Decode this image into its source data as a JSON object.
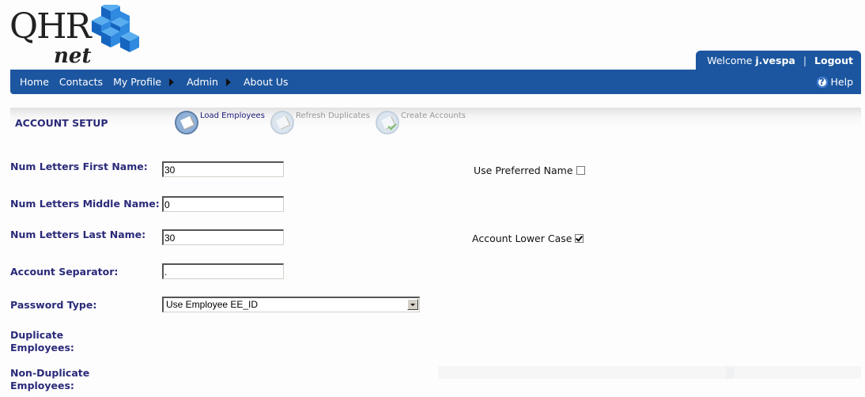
{
  "logo": {
    "brand": "QHR",
    "suffix": "net",
    "colors": {
      "cube_blue": "#1e7bd6",
      "text": "#222222"
    }
  },
  "user_bar": {
    "welcome_prefix": "Welcome",
    "username": "j.vespa",
    "separator": "|",
    "logout_label": "Logout"
  },
  "nav": {
    "items": [
      {
        "label": "Home",
        "has_submenu": false
      },
      {
        "label": "Contacts",
        "has_submenu": false
      },
      {
        "label": "My Profile",
        "has_submenu": true
      },
      {
        "label": "Admin",
        "has_submenu": true
      },
      {
        "label": "About Us",
        "has_submenu": false
      }
    ],
    "help_label": "Help",
    "help_icon": "question-circle-icon",
    "bar_color": "#1c56a0"
  },
  "setup": {
    "title": "ACCOUNT SETUP",
    "steps": [
      {
        "label": "Load Employees",
        "state": "active",
        "icon": "document-icon"
      },
      {
        "label": "Refresh Duplicates",
        "state": "inactive",
        "icon": "documents-icon"
      },
      {
        "label": "Create Accounts",
        "state": "inactive",
        "icon": "document-check-icon"
      }
    ]
  },
  "form": {
    "first_name_letters": {
      "label": "Num Letters First Name:",
      "value": "30"
    },
    "middle_name_letters": {
      "label": "Num Letters Middle Name:",
      "value": "0"
    },
    "last_name_letters": {
      "label": "Num Letters Last Name:",
      "value": "30"
    },
    "account_separator": {
      "label": "Account Separator:",
      "value": "."
    },
    "password_type": {
      "label": "Password Type:",
      "selected": "Use Employee EE_ID"
    },
    "duplicate_employees": {
      "label_line1": "Duplicate",
      "label_line2": "Employees:"
    },
    "non_duplicate_employees": {
      "label_line1": "Non-Duplicate",
      "label_line2": "Employees:"
    },
    "use_preferred_name": {
      "label": "Use Preferred Name",
      "checked": false
    },
    "account_lower_case": {
      "label": "Account Lower Case",
      "checked": true
    }
  }
}
